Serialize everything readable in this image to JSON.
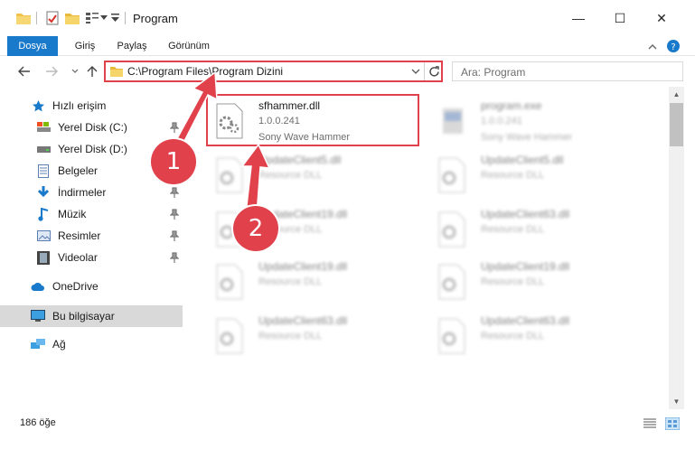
{
  "window": {
    "title": "Program",
    "minimize": "—",
    "maximize": "☐",
    "close": "✕"
  },
  "ribbon": {
    "tabs": [
      "Dosya",
      "Giriş",
      "Paylaş",
      "Görünüm"
    ]
  },
  "address": {
    "path": "C:\\Program Files\\Program Dizini"
  },
  "search": {
    "placeholder": "Ara: Program"
  },
  "sidebar": {
    "items": [
      {
        "label": "Hızlı erişim",
        "icon": "star-icon"
      },
      {
        "label": "Yerel Disk (C:)",
        "icon": "drive-icon",
        "pinned": true
      },
      {
        "label": "Yerel Disk (D:)",
        "icon": "drive-icon",
        "pinned": true
      },
      {
        "label": "Belgeler",
        "icon": "documents-icon",
        "pinned": true
      },
      {
        "label": "İndirmeler",
        "icon": "download-icon",
        "pinned": true
      },
      {
        "label": "Müzik",
        "icon": "music-icon",
        "pinned": true
      },
      {
        "label": "Resimler",
        "icon": "pictures-icon",
        "pinned": true
      },
      {
        "label": "Videolar",
        "icon": "video-icon",
        "pinned": true
      },
      {
        "label": "OneDrive",
        "icon": "cloud-icon"
      },
      {
        "label": "Bu bilgisayar",
        "icon": "computer-icon",
        "selected": true
      },
      {
        "label": "Ağ",
        "icon": "network-icon"
      }
    ]
  },
  "files": [
    {
      "name": "sfhammer.dll",
      "version": "1.0.0.241",
      "description": "Sony Wave Hammer",
      "highlighted": true
    },
    {
      "name": "program.exe",
      "version": "1.0.0.241",
      "description": "Sony Wave Hammer"
    },
    {
      "name": "UpdateClient5.dll",
      "description": "Resource DLL"
    },
    {
      "name": "UpdateClient5.dll",
      "description": "Resource DLL"
    },
    {
      "name": "UpdateClient19.dll",
      "description": "Resource DLL"
    },
    {
      "name": "UpdateClient63.dll",
      "description": "Resource DLL"
    },
    {
      "name": "UpdateClient19.dll",
      "description": "Resource DLL"
    },
    {
      "name": "UpdateClient19.dll",
      "description": "Resource DLL"
    },
    {
      "name": "UpdateClient63.dll",
      "description": "Resource DLL"
    },
    {
      "name": "UpdateClient63.dll",
      "description": "Resource DLL"
    }
  ],
  "status": {
    "count": "186 öğe"
  },
  "annotations": {
    "marker1": "1",
    "marker2": "2",
    "color": "#e0414b"
  },
  "colors": {
    "accent": "#1979ca",
    "highlight": "#e0414b",
    "selected": "#d9d9d9"
  }
}
